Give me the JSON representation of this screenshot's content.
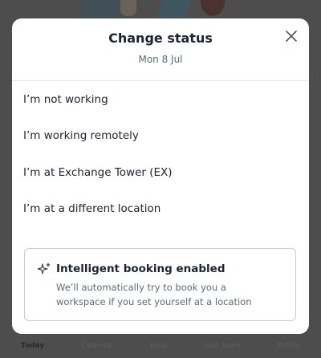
{
  "dialog": {
    "title": "Change status",
    "date": "Mon 8 Jul",
    "close_icon": "close-icon"
  },
  "options": [
    {
      "label": "I’m not working"
    },
    {
      "label": "I’m working remotely"
    },
    {
      "label": "I’m at Exchange Tower (EX)"
    },
    {
      "label": "I’m at a different location"
    }
  ],
  "booking": {
    "icon": "sparkle-icon",
    "title": "Intelligent booking enabled",
    "line1": "We’ll automatically try to book you a",
    "line2": "workspace if you set yourself at a location"
  },
  "tabbar": {
    "items": [
      {
        "label": "Today",
        "active": true
      },
      {
        "label": "Calendar"
      },
      {
        "label": "Book"
      },
      {
        "label": "Your team"
      },
      {
        "label": "Profile"
      }
    ]
  },
  "colors": {
    "overlay": "#4d4d4d",
    "text_primary": "#1c2430",
    "text_secondary": "#5b6b78",
    "card_border": "#c4ccd4"
  }
}
